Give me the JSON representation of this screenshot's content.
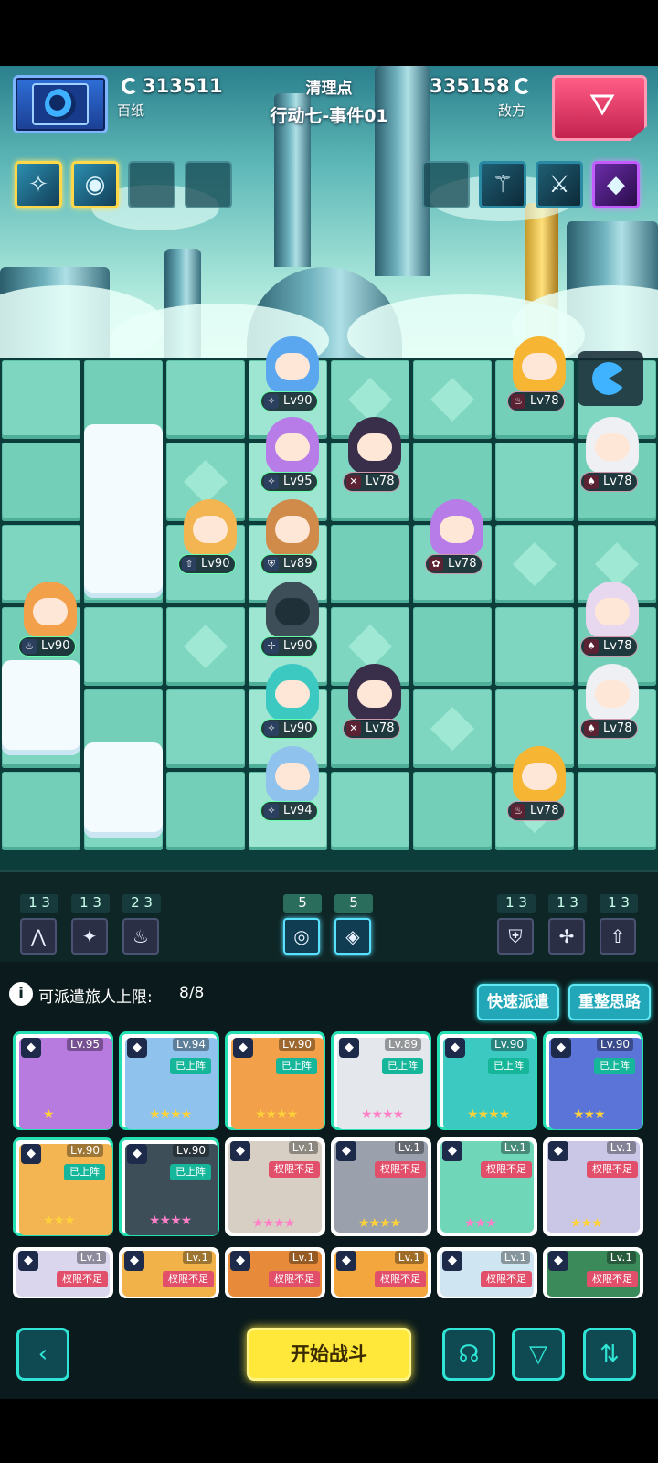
{
  "header": {
    "player_score": "313511",
    "player_label": "百纸",
    "enemy_score": "335158",
    "enemy_label": "敌方",
    "title": "清理点",
    "subtitle": "行动七-事件01"
  },
  "board": {
    "units": [
      {
        "side": "enemy",
        "level": "Lv78",
        "cls": "♨"
      },
      {
        "side": "enemy",
        "level": "Lv78",
        "cls": "♠"
      },
      {
        "side": "enemy",
        "level": "Lv78",
        "cls": "✕"
      },
      {
        "side": "enemy",
        "level": "Lv78",
        "cls": "✿"
      },
      {
        "side": "enemy",
        "level": "Lv78",
        "cls": "♠"
      },
      {
        "side": "enemy",
        "level": "Lv78",
        "cls": "♠"
      },
      {
        "side": "enemy",
        "level": "Lv78",
        "cls": "✕"
      },
      {
        "side": "enemy",
        "level": "Lv78",
        "cls": "♠"
      },
      {
        "side": "enemy",
        "level": "Lv78",
        "cls": "♨"
      },
      {
        "side": "ally",
        "level": "Lv90",
        "cls": "✧"
      },
      {
        "side": "ally",
        "level": "Lv95",
        "cls": "✧"
      },
      {
        "side": "ally",
        "level": "Lv90",
        "cls": "⇧"
      },
      {
        "side": "ally",
        "level": "Lv89",
        "cls": "⛨"
      },
      {
        "side": "ally",
        "level": "Lv90",
        "cls": "♨"
      },
      {
        "side": "ally",
        "level": "Lv90",
        "cls": "✢"
      },
      {
        "side": "ally",
        "level": "Lv90",
        "cls": "✧"
      },
      {
        "side": "ally",
        "level": "Lv94",
        "cls": "✧"
      }
    ]
  },
  "synergy": {
    "left": [
      {
        "count": "1 3",
        "icon": "⋀"
      },
      {
        "count": "1 3",
        "icon": "✦"
      },
      {
        "count": "2 3",
        "icon": "♨"
      }
    ],
    "center": [
      {
        "count": "5",
        "icon": "◎"
      },
      {
        "count": "5",
        "icon": "◈"
      }
    ],
    "right": [
      {
        "count": "1 3",
        "icon": "⛨"
      },
      {
        "count": "1 3",
        "icon": "✢"
      },
      {
        "count": "1 3",
        "icon": "⇧"
      }
    ]
  },
  "roster": {
    "limit_label": "可派遣旅人上限:",
    "limit_value": "8/8",
    "quick_dispatch": "快速派遣",
    "reset": "重整思路",
    "cards": [
      {
        "level": "Lv.95",
        "tag": "",
        "tag_type": "",
        "stars": "★",
        "star_color": "gold",
        "color": "#b77be0"
      },
      {
        "level": "Lv.94",
        "tag": "已上阵",
        "tag_type": "ok",
        "stars": "★★★★",
        "star_color": "gold",
        "color": "#8fc2ec"
      },
      {
        "level": "Lv.90",
        "tag": "已上阵",
        "tag_type": "ok",
        "stars": "★★★★",
        "star_color": "gold",
        "color": "#f2a04a"
      },
      {
        "level": "Lv.89",
        "tag": "已上阵",
        "tag_type": "ok",
        "stars": "★★★★",
        "star_color": "pink",
        "color": "#e4e8ec"
      },
      {
        "level": "Lv.90",
        "tag": "已上阵",
        "tag_type": "ok",
        "stars": "★★★★",
        "star_color": "gold",
        "color": "#3cc9c2"
      },
      {
        "level": "Lv.90",
        "tag": "已上阵",
        "tag_type": "ok",
        "stars": "★★★",
        "star_color": "gold",
        "color": "#5a74d8"
      },
      {
        "level": "Lv.90",
        "tag": "已上阵",
        "tag_type": "ok",
        "stars": "★★★",
        "star_color": "gold",
        "color": "#f3b552"
      },
      {
        "level": "Lv.90",
        "tag": "已上阵",
        "tag_type": "ok",
        "stars": "★★★★",
        "star_color": "pink",
        "color": "#3d4e58"
      },
      {
        "level": "Lv.1",
        "tag": "权限不足",
        "tag_type": "no",
        "stars": "★★★★",
        "star_color": "pink",
        "color": "#d8cfc4"
      },
      {
        "level": "Lv.1",
        "tag": "权限不足",
        "tag_type": "no",
        "stars": "★★★★",
        "star_color": "gold",
        "color": "#9aa0ac"
      },
      {
        "level": "Lv.1",
        "tag": "权限不足",
        "tag_type": "no",
        "stars": "★★★",
        "star_color": "pink",
        "color": "#6fd6b8"
      },
      {
        "level": "Lv.1",
        "tag": "权限不足",
        "tag_type": "no",
        "stars": "★★★",
        "star_color": "gold",
        "color": "#c9c6e6"
      },
      {
        "level": "Lv.1",
        "tag": "权限不足",
        "tag_type": "no",
        "stars": "",
        "star_color": "gold",
        "color": "#d9d6ee"
      },
      {
        "level": "Lv.1",
        "tag": "权限不足",
        "tag_type": "no",
        "stars": "",
        "star_color": "gold",
        "color": "#f2b24a"
      },
      {
        "level": "Lv.1",
        "tag": "权限不足",
        "tag_type": "no",
        "stars": "",
        "star_color": "gold",
        "color": "#e78a3a"
      },
      {
        "level": "Lv.1",
        "tag": "权限不足",
        "tag_type": "no",
        "stars": "",
        "star_color": "gold",
        "color": "#f4a63e"
      },
      {
        "level": "Lv.1",
        "tag": "权限不足",
        "tag_type": "no",
        "stars": "",
        "star_color": "gold",
        "color": "#cfe6f2"
      },
      {
        "level": "Lv.1",
        "tag": "权限不足",
        "tag_type": "no",
        "stars": "",
        "star_color": "gold",
        "color": "#3b8a5a"
      }
    ]
  },
  "footer": {
    "start": "开始战斗",
    "back_icon": "chevron-left-icon",
    "brain_icon": "brain-icon",
    "filter_icon": "filter-icon",
    "sort_icon": "sort-icon"
  }
}
